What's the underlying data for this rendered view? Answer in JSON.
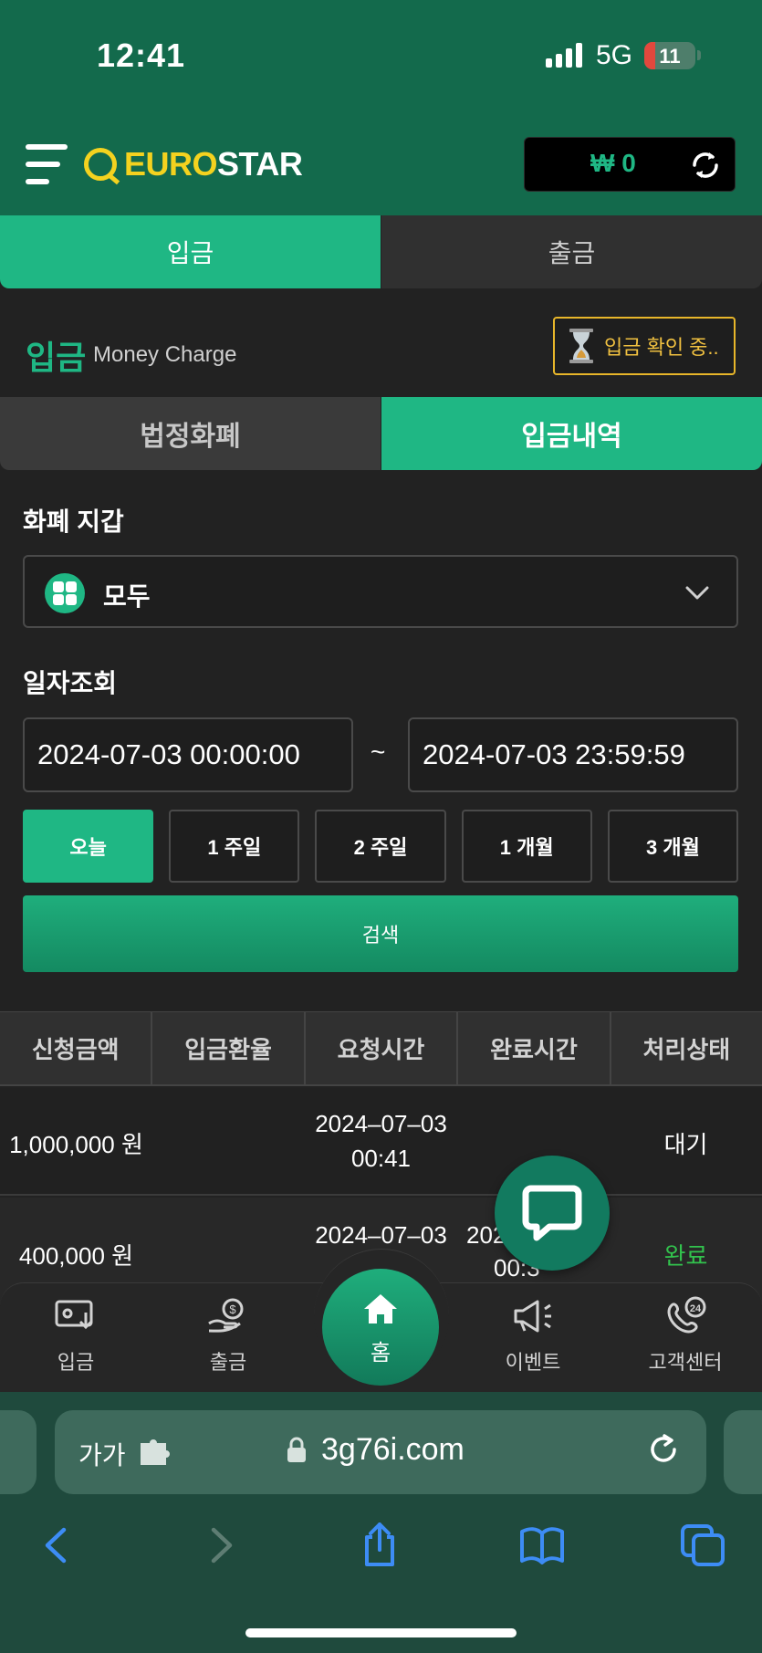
{
  "status": {
    "time": "12:41",
    "network": "5G",
    "battery": "11"
  },
  "header": {
    "logo_part1": "EURO",
    "logo_part2": "STAR",
    "balance": "₩ 0"
  },
  "main_tabs": [
    {
      "label": "입금"
    },
    {
      "label": "출금"
    }
  ],
  "charge": {
    "title": "입금",
    "subtitle": "Money Charge",
    "pending_label": "입금 확인 중.."
  },
  "sub_tabs": [
    {
      "label": "법정화폐"
    },
    {
      "label": "입금내역"
    }
  ],
  "wallet": {
    "label": "화폐 지갑",
    "selected": "모두"
  },
  "date_filter": {
    "label": "일자조회",
    "from": "2024-07-03 00:00:00",
    "separator": "~",
    "to": "2024-07-03 23:59:59"
  },
  "periods": [
    "오늘",
    "1 주일",
    "2 주일",
    "1 개월",
    "3 개월"
  ],
  "search_label": "검색",
  "table": {
    "headers": [
      "신청금액",
      "입금환율",
      "요청시간",
      "완료시간",
      "처리상태"
    ],
    "rows": [
      {
        "amount": "1,000,000 원",
        "rate": "",
        "req_date": "2024–07–03",
        "req_time": "00:41",
        "done_date": "",
        "done_time": "",
        "status": "대기"
      },
      {
        "amount": "400,000 원",
        "rate": "",
        "req_date": "2024–07–03",
        "req_time": "",
        "done_date": "202",
        "done_time": "00:3",
        "status": "완료"
      }
    ]
  },
  "bottom_nav": {
    "deposit": "입금",
    "withdraw": "출금",
    "home": "홈",
    "event": "이벤트",
    "support": "고객센터"
  },
  "browser": {
    "text_size": "가가",
    "url": "3g76i.com"
  },
  "colors": {
    "accent": "#1fb784",
    "header": "#136a4c",
    "warning": "#e8b62a",
    "done": "#32c24d"
  }
}
